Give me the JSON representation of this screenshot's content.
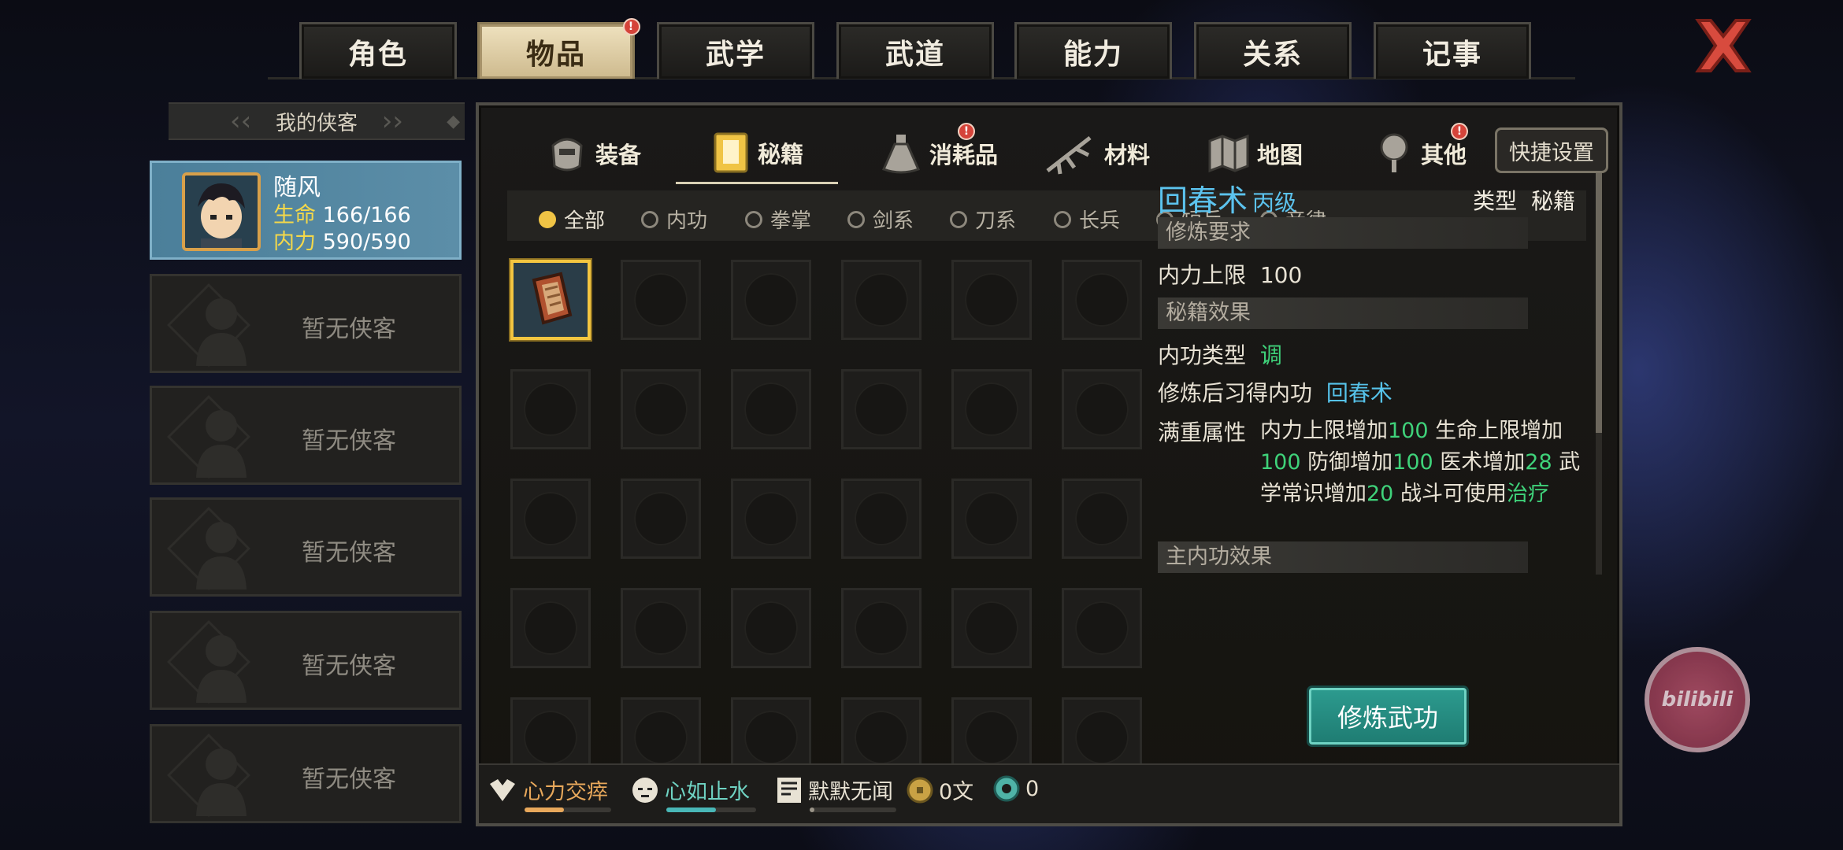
{
  "top_tabs": [
    {
      "label": "角色"
    },
    {
      "label": "物品",
      "badge": "!"
    },
    {
      "label": "武学"
    },
    {
      "label": "武道"
    },
    {
      "label": "能力"
    },
    {
      "label": "关系"
    },
    {
      "label": "记事"
    }
  ],
  "party": {
    "header": "我的侠客",
    "active": {
      "name": "随风",
      "hp_label": "生命",
      "hp": "166/166",
      "mp_label": "内力",
      "mp": "590/590"
    },
    "empty_label": "暂无侠客",
    "empty_slots": 5
  },
  "categories": [
    {
      "label": "装备",
      "icon": "armor-icon"
    },
    {
      "label": "秘籍",
      "icon": "book-icon"
    },
    {
      "label": "消耗品",
      "icon": "potion-icon",
      "badge": "!"
    },
    {
      "label": "材料",
      "icon": "herb-icon"
    },
    {
      "label": "地图",
      "icon": "map-icon"
    },
    {
      "label": "其他",
      "icon": "lantern-icon",
      "badge": "!"
    }
  ],
  "quick_settings": "快捷设置",
  "filters": [
    "全部",
    "内功",
    "拳掌",
    "剑系",
    "刀系",
    "长兵",
    "短兵",
    "音律"
  ],
  "detail": {
    "name": "回春术",
    "grade": "丙级",
    "type_label": "类型",
    "type_value": "秘籍",
    "req_header": "修炼要求",
    "req_label": "内力上限",
    "req_value": "100",
    "effect_header": "秘籍效果",
    "neigong_type_label": "内功类型",
    "neigong_type_value": "调",
    "learn_label": "修炼后习得内功",
    "learn_value": "回春术",
    "full_label": "满重属性",
    "full_text": {
      "p1": "内力上限增加",
      "v1": "100",
      "p2": "生命上限增加",
      "v2": "100",
      "p3": "防御增加",
      "v3": "100",
      "p4": "医术增加",
      "v4": "28",
      "p5": "武学常识增加",
      "v5": "20",
      "p6": "战斗可使用",
      "v6": "治疗"
    },
    "main_header": "主内功效果",
    "train_button": "修炼武功"
  },
  "status_bar": {
    "buff1": "心力交瘁",
    "buff1_level": 0.45,
    "buff2": "心如止水",
    "buff2_level": 0.55,
    "buff3": "默默无闻",
    "buff3_level": 0.05,
    "money": "0文",
    "jade": "0"
  },
  "bilibili": "bilibili",
  "colors": {
    "accent_cyan": "#5cc3ee",
    "value_green": "#3fd27a",
    "active_tab": "#efe2bf",
    "train_button": "#2c9a8e"
  }
}
